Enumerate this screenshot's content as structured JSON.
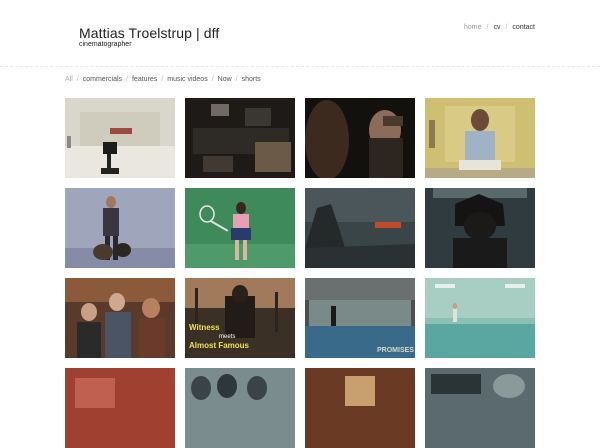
{
  "brand": {
    "title": "Mattias Troelstrup | dff",
    "subtitle": "cinematographer"
  },
  "topnav": {
    "items": [
      "home",
      "cv",
      "contact"
    ],
    "separator": "/"
  },
  "filters": {
    "all": "All",
    "items": [
      "commercials",
      "features",
      "music videos",
      "Now",
      "shorts"
    ],
    "separator": "/"
  },
  "thumbnails": [
    {
      "name": "thumb-empty-room-camera",
      "overlay": ""
    },
    {
      "name": "thumb-studio-set",
      "overlay": ""
    },
    {
      "name": "thumb-woman-horse",
      "overlay": ""
    },
    {
      "name": "thumb-man-yellow-room",
      "overlay": ""
    },
    {
      "name": "thumb-man-dogs",
      "overlay": ""
    },
    {
      "name": "thumb-tennis-player",
      "overlay": ""
    },
    {
      "name": "thumb-dark-landscape",
      "overlay": ""
    },
    {
      "name": "thumb-hooded-figure",
      "overlay": ""
    },
    {
      "name": "thumb-people-restaurant",
      "overlay": ""
    },
    {
      "name": "thumb-witness-almost-famous",
      "overlay": "Witness meets Almost Famous"
    },
    {
      "name": "thumb-pool-house",
      "overlay": "PROMISES"
    },
    {
      "name": "thumb-teal-pool",
      "overlay": ""
    },
    {
      "name": "thumb-row4-red",
      "overlay": ""
    },
    {
      "name": "thumb-row4-helmets",
      "overlay": ""
    },
    {
      "name": "thumb-row4-warm",
      "overlay": ""
    },
    {
      "name": "thumb-row4-car",
      "overlay": ""
    }
  ]
}
